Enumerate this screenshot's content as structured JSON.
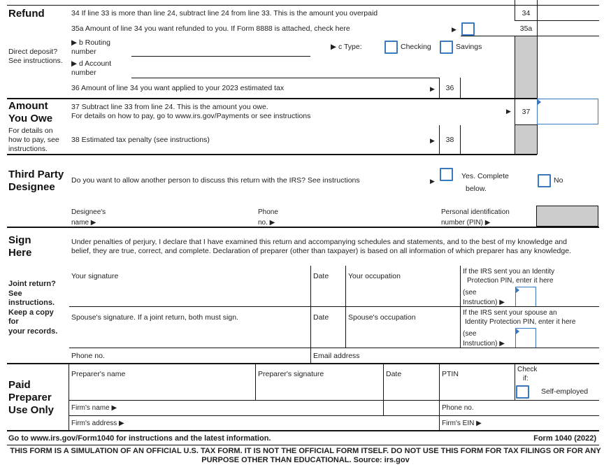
{
  "refund": {
    "heading": "Refund",
    "side_note": [
      "Direct deposit?",
      "See instructions."
    ],
    "line34": {
      "text": "34 If line 33 is more than line 24, subtract line 24 from line 33. This is the amount you overpaid",
      "num": "34"
    },
    "line35a": {
      "text": "35a Amount of line 34 you want refunded to you. If Form 8888 is attached, check here",
      "num": "35a"
    },
    "line35b": {
      "label": "▶ b Routing",
      "label2": "number"
    },
    "line35c": {
      "label": "▶ c Type:",
      "checking": "Checking",
      "savings": "Savings"
    },
    "line35d": {
      "label": "▶ d Account",
      "label2": "number"
    },
    "line36": {
      "text": "36 Amount of line 34 you want applied to your 2023 estimated tax",
      "num": "36"
    }
  },
  "amount_owe": {
    "heading_line1": "Amount",
    "heading_line2": "You Owe",
    "side_note": [
      "For details on",
      "how to pay, see",
      "instructions."
    ],
    "line37": {
      "text1": "37 Subtract line 33 from line 24. This is the amount you owe.",
      "text2": "For details on how to pay, go to www.irs.gov/Payments or see instructions",
      "num": "37"
    },
    "line38": {
      "text": "38 Estimated tax penalty (see instructions)",
      "num": "38"
    }
  },
  "designee": {
    "heading_line1": "Third Party",
    "heading_line2": "Designee",
    "question": "Do you want to allow another person to discuss this return with the IRS? See instructions",
    "yes_label1": "Yes. Complete",
    "yes_label2": "below.",
    "no_label": "No",
    "name_label1": "Designee's",
    "name_label2": "name ▶",
    "phone_label1": "Phone",
    "phone_label2": "no. ▶",
    "pin_label1": "Personal identification",
    "pin_label2": "number (PIN) ▶"
  },
  "sign": {
    "heading_line1": "Sign",
    "heading_line2": "Here",
    "side_note": [
      "Joint return?",
      "See",
      "instructions.",
      "Keep a copy",
      "for",
      "your records."
    ],
    "declaration1": "Under penalties of perjury, I declare that I have examined this return and accompanying schedules and statements, and to the best of my knowledge and",
    "declaration2": "belief, they are true, correct, and complete. Declaration of preparer (other than taxpayer) is based on all information of which preparer has any knowledge.",
    "your_signature": "Your signature",
    "date": "Date",
    "your_occupation": "Your occupation",
    "ip_pin_you1": "If the IRS sent you an Identity",
    "ip_pin_you2": "Protection PIN, enter it here",
    "see1": "(see",
    "see2": "Instruction) ▶",
    "spouse_signature": "Spouse's signature. If a joint return, both must sign.",
    "spouse_occupation": "Spouse's occupation",
    "ip_pin_spouse1": "If the IRS sent your spouse an",
    "ip_pin_spouse2": "Identity Protection PIN, enter it here",
    "phone": "Phone no.",
    "email": "Email address"
  },
  "preparer": {
    "heading_line1": "Paid",
    "heading_line2": "Preparer",
    "heading_line3": "Use Only",
    "preparer_name": "Preparer's name",
    "preparer_signature": "Preparer's signature",
    "date": "Date",
    "ptin": "PTIN",
    "check1": "Check",
    "check2": "if:",
    "self_employed": "Self-employed",
    "firm_name": "Firm's name ▶",
    "phone": "Phone no.",
    "firm_address": "Firm's address ▶",
    "firm_ein": "Firm's EIN ▶"
  },
  "footer": {
    "left": "Go to www.irs.gov/Form1040 for instructions and the latest information.",
    "right": "Form 1040 (2022)",
    "disclaimer1": "THIS FORM IS A SIMULATION OF AN OFFICIAL U.S. TAX FORM. IT IS NOT THE OFFICIAL FORM ITSELF. DO NOT USE THIS FORM FOR TAX FILINGS OR FOR ANY",
    "disclaimer2": "PURPOSE OTHER THAN EDUCATIONAL. Source: irs.gov"
  },
  "arrow_glyph": "▶",
  "colors": {
    "checkbox": "#3a78c0",
    "shaded": "#cccccc"
  }
}
